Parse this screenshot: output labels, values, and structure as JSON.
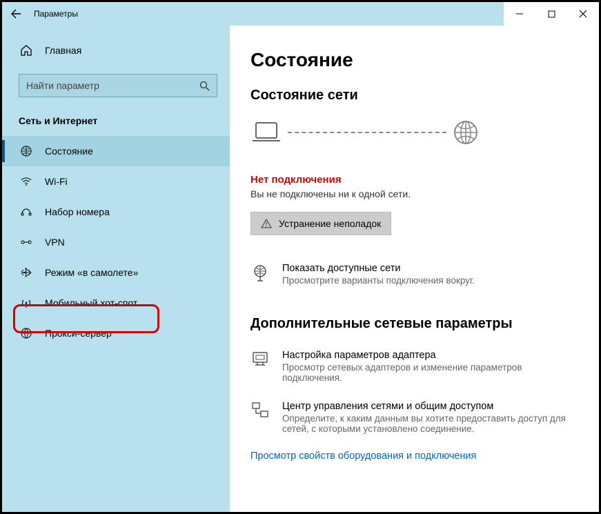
{
  "titlebar": {
    "title": "Параметры"
  },
  "sidebar": {
    "home": "Главная",
    "search_placeholder": "Найти параметр",
    "section": "Сеть и Интернет",
    "items": [
      {
        "label": "Состояние"
      },
      {
        "label": "Wi-Fi"
      },
      {
        "label": "Набор номера"
      },
      {
        "label": "VPN"
      },
      {
        "label": "Режим «в самолете»"
      },
      {
        "label": "Мобильный хот-спот"
      },
      {
        "label": "Прокси-сервер"
      }
    ]
  },
  "main": {
    "page_title": "Состояние",
    "section_status": "Состояние сети",
    "error_title": "Нет подключения",
    "error_sub": "Вы не подключены ни к одной сети.",
    "troubleshoot": "Устранение неполадок",
    "show_networks": {
      "title": "Показать доступные сети",
      "desc": "Просмотрите варианты подключения вокруг."
    },
    "advanced_title": "Дополнительные сетевые параметры",
    "adapter": {
      "title": "Настройка параметров адаптера",
      "desc": "Просмотр сетевых адаптеров и изменение параметров подключения."
    },
    "sharing": {
      "title": "Центр управления сетями и общим доступом",
      "desc": "Определите, к каким данным вы хотите предоставить доступ для сетей, с которыми установлено соединение."
    },
    "hardware_link": "Просмотр свойств оборудования и подключения"
  }
}
